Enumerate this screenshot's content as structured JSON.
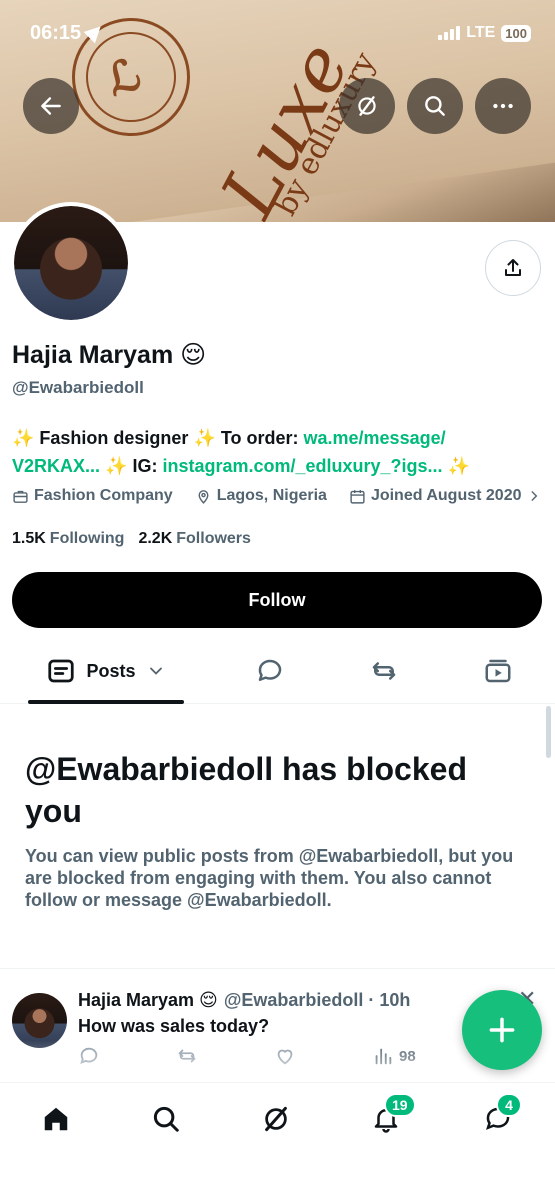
{
  "status_bar": {
    "time": "06:15",
    "network": "LTE",
    "battery": "100"
  },
  "banner": {
    "brand_script": "Luxe",
    "brand_sub": "by edluxury"
  },
  "header_buttons": {
    "back_icon": "arrow-left-icon",
    "grok_icon": "grok-icon",
    "search_icon": "search-icon",
    "more_icon": "more-icon"
  },
  "profile": {
    "display_name": "Hajia Maryam 😌",
    "handle": "@Ewabarbiedoll",
    "bio": {
      "part1": "✨ Fashion designer ✨ To order: ",
      "link1": "wa.me/message/",
      "link1b": "V2RKAX...",
      "part2": " ✨ IG: ",
      "link2": "instagram.com/_edluxury_?igs...",
      "part3": " ✨"
    },
    "category": "Fashion Company",
    "location": "Lagos, Nigeria",
    "joined": "Joined August 2020",
    "following_count": "1.5K",
    "following_label": "Following",
    "followers_count": "2.2K",
    "followers_label": "Followers"
  },
  "follow_button": "Follow",
  "tabs": {
    "posts_label": "Posts"
  },
  "blocked": {
    "title": "@Ewabarbiedoll has blocked you",
    "text": "You can view public posts from @Ewabarbiedoll, but you are blocked from engaging with them. You also cannot follow or message @Ewabarbiedoll."
  },
  "post": {
    "name": "Hajia Maryam 😌",
    "handle_time": "@Ewabarbiedoll · 10h",
    "text": "How was sales today?",
    "views": "98"
  },
  "bottom_nav": {
    "notifications_badge": "19",
    "messages_badge": "4"
  },
  "colors": {
    "accent": "#00ba7c",
    "fab": "#17bf7c",
    "text": "#0f1419",
    "muted": "#536471"
  }
}
